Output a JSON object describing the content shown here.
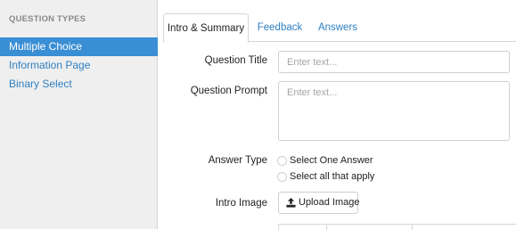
{
  "sidebar": {
    "header": "QUESTION TYPES",
    "items": [
      {
        "label": "Multiple Choice",
        "active": true
      },
      {
        "label": "Information Page",
        "active": false
      },
      {
        "label": "Binary Select",
        "active": false
      }
    ]
  },
  "tabs": [
    {
      "label": "Intro & Summary",
      "active": true
    },
    {
      "label": "Feedback",
      "active": false
    },
    {
      "label": "Answers",
      "active": false
    }
  ],
  "form": {
    "question_title": {
      "label": "Question Title",
      "value": "",
      "placeholder": "Enter text..."
    },
    "question_prompt": {
      "label": "Question Prompt",
      "value": "",
      "placeholder": "Enter text..."
    },
    "answer_type": {
      "label": "Answer Type",
      "options": [
        "Select One Answer",
        "Select all that apply"
      ],
      "selected": null
    },
    "intro_image": {
      "label": "Intro Image",
      "button_label": "Upload Image",
      "icon": "upload-icon"
    }
  },
  "colors": {
    "accent": "#3a8ed4",
    "link": "#2f7fc1",
    "sidebar_bg": "#efefef",
    "border": "#d6d6d6"
  }
}
